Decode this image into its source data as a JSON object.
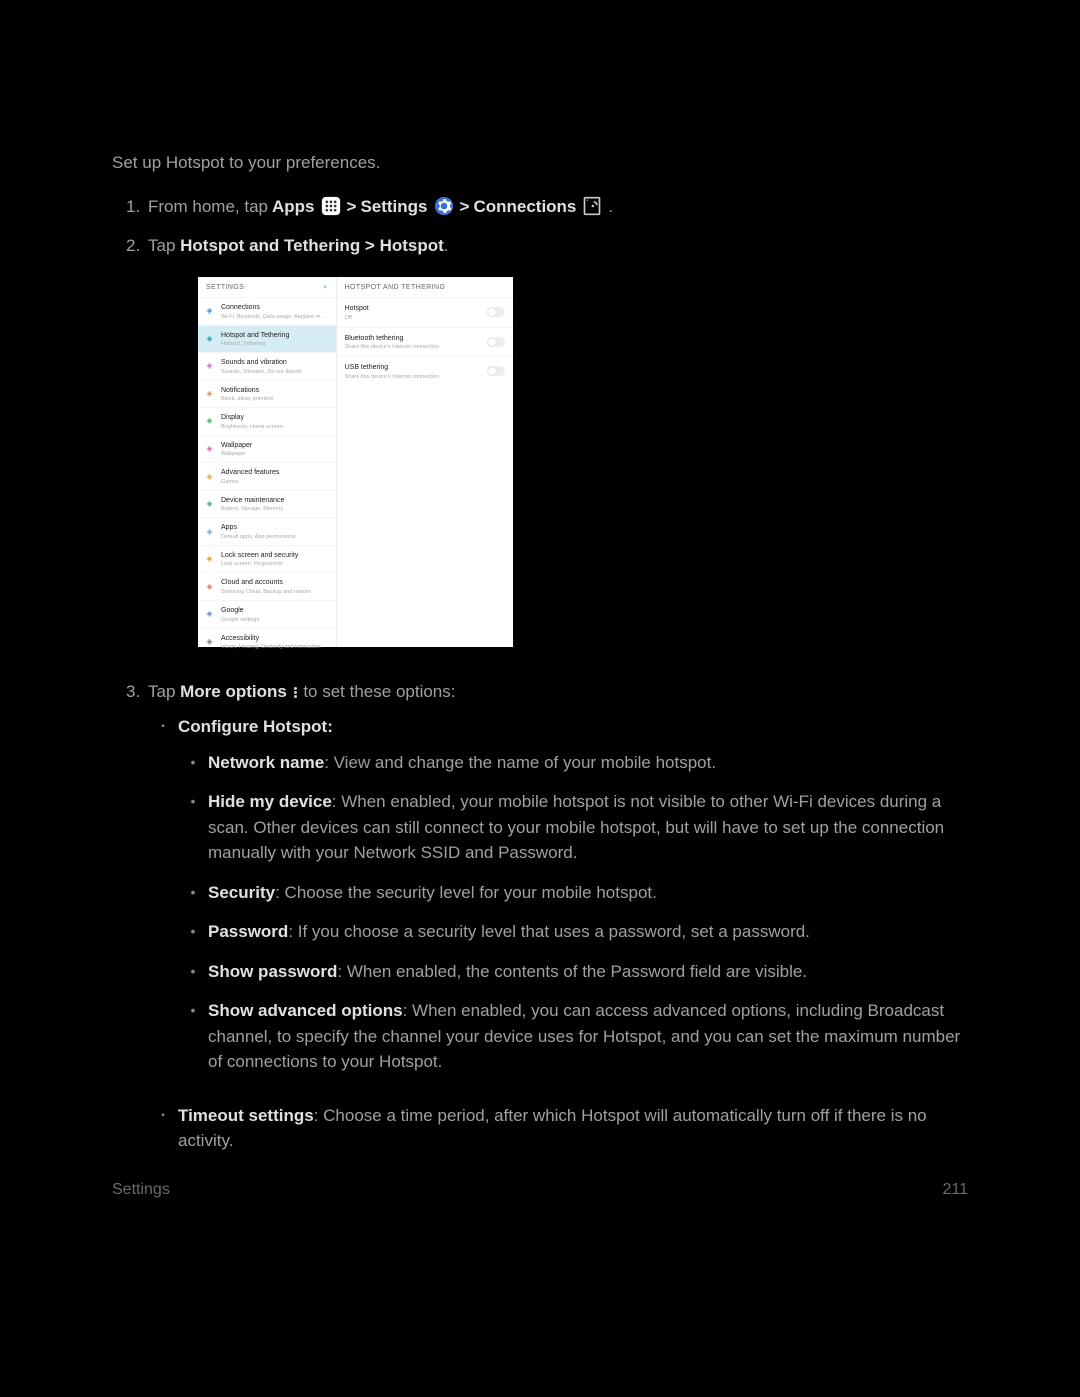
{
  "intro": "Set up Hotspot to your preferences.",
  "steps": {
    "s1": {
      "n": "1.",
      "pre": "From home, tap ",
      "apps": "Apps",
      "gt1": " > ",
      "settings": "Settings",
      "gt2": " > ",
      "connections": "Connections",
      "period": "."
    },
    "s2": {
      "n": "2.",
      "pre": "Tap ",
      "path": "Hotspot and Tethering > Hotspot",
      "period": "."
    },
    "s3": {
      "n": "3.",
      "pre": "Tap ",
      "more": "More options",
      "post": " to set these options:"
    }
  },
  "screenshot": {
    "left_header": "SETTINGS",
    "right_header": "HOTSPOT AND TETHERING",
    "left_items": [
      {
        "title": "Connections",
        "sub": "Wi-Fi, Bluetooth, Data usage, Airplane m...",
        "color": "#3b8fd6"
      },
      {
        "title": "Hotspot and Tethering",
        "sub": "Hotspot, Tethering",
        "color": "#1aa3a3",
        "sel": true
      },
      {
        "title": "Sounds and vibration",
        "sub": "Sounds, Vibration, Do not disturb",
        "color": "#d36bb7"
      },
      {
        "title": "Notifications",
        "sub": "Block, allow, prioritize",
        "color": "#e38b4a"
      },
      {
        "title": "Display",
        "sub": "Brightness, Home screen",
        "color": "#4fae5e"
      },
      {
        "title": "Wallpaper",
        "sub": "Wallpaper",
        "color": "#d65fa0"
      },
      {
        "title": "Advanced features",
        "sub": "Games",
        "color": "#e0a33b"
      },
      {
        "title": "Device maintenance",
        "sub": "Battery, Storage, Memory",
        "color": "#3ba3a3"
      },
      {
        "title": "Apps",
        "sub": "Default apps, App permissions",
        "color": "#7aa7d6"
      },
      {
        "title": "Lock screen and security",
        "sub": "Lock screen, Fingerprints",
        "color": "#d6a03b"
      },
      {
        "title": "Cloud and accounts",
        "sub": "Samsung Cloud, Backup and restore",
        "color": "#d67a5f"
      },
      {
        "title": "Google",
        "sub": "Google settings",
        "color": "#5f8fd6"
      },
      {
        "title": "Accessibility",
        "sub": "Vision, Hearing, Dexterity and interaction",
        "color": "#7a7a7a"
      }
    ],
    "right_items": [
      {
        "title": "Hotspot",
        "sub": "Off"
      },
      {
        "title": "Bluetooth tethering",
        "sub": "Share this device's Internet connection"
      },
      {
        "title": "USB tethering",
        "sub": "Share this device's Internet connection"
      }
    ]
  },
  "configure": {
    "heading": "Configure Hotspot:",
    "items": {
      "network_name": {
        "label": "Network name",
        "text": ": View and change the name of your mobile hotspot."
      },
      "hide_my_device": {
        "label": "Hide my device",
        "text": ": When enabled, your mobile hotspot is not visible to other Wi-Fi devices during a scan. Other devices can still connect to your mobile hotspot, but will have to set up the connection manually with your Network SSID and Password."
      },
      "security": {
        "label": "Security",
        "text": ": Choose the security level for your mobile hotspot."
      },
      "password": {
        "label": "Password",
        "text": ": If you choose a security level that uses a password, set a password."
      },
      "show_password": {
        "label": "Show password",
        "text": ": When enabled, the contents of the Password field are visible."
      },
      "show_advanced": {
        "label": "Show advanced options",
        "text": ": When enabled, you can access advanced options, including Broadcast channel, to specify the channel your device uses for Hotspot, and you can set the maximum number of connections to your Hotspot."
      }
    },
    "timeout": {
      "label": "Timeout settings",
      "text": ": Choose a time period, after which Hotspot will automatically turn off if there is no activity."
    }
  },
  "footer": {
    "left": "Settings",
    "right": "211"
  }
}
